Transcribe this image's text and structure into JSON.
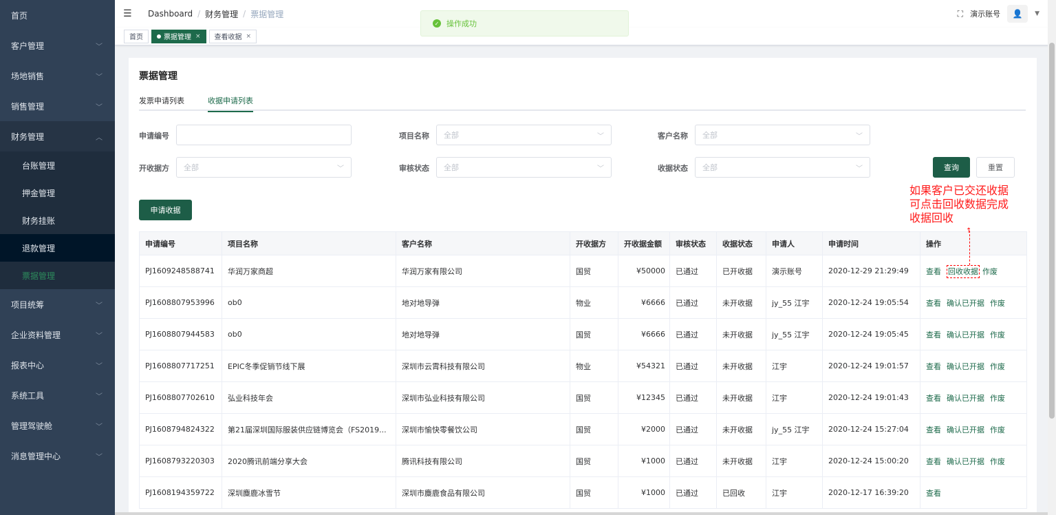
{
  "sidebar": {
    "items": [
      {
        "label": "首页",
        "has_children": false
      },
      {
        "label": "客户管理",
        "has_children": true
      },
      {
        "label": "场地销售",
        "has_children": true
      },
      {
        "label": "销售管理",
        "has_children": true
      },
      {
        "label": "财务管理",
        "has_children": true,
        "open": true
      },
      {
        "label": "项目统筹",
        "has_children": true
      },
      {
        "label": "企业资料管理",
        "has_children": true
      },
      {
        "label": "报表中心",
        "has_children": true
      },
      {
        "label": "系统工具",
        "has_children": true
      },
      {
        "label": "管理驾驶舱",
        "has_children": true
      },
      {
        "label": "消息管理中心",
        "has_children": true
      }
    ],
    "finance_sub": [
      "台账管理",
      "押金管理",
      "财务挂账",
      "退款管理",
      "票据管理"
    ]
  },
  "header": {
    "breadcrumb": [
      "Dashboard",
      "财务管理",
      "票据管理"
    ],
    "account": "演示账号"
  },
  "tags": [
    {
      "label": "首页",
      "active": false,
      "closable": false
    },
    {
      "label": "票据管理",
      "active": true,
      "closable": true
    },
    {
      "label": "查看收据",
      "active": false,
      "closable": true
    }
  ],
  "toast": {
    "message": "操作成功"
  },
  "page": {
    "title": "票据管理",
    "tabs": [
      "发票申请列表",
      "收据申请列表"
    ]
  },
  "filters": {
    "apply_no_label": "申请编号",
    "project_label": "项目名称",
    "project_placeholder": "全部",
    "customer_label": "客户名称",
    "customer_placeholder": "全部",
    "issuer_label": "开收据方",
    "issuer_placeholder": "全部",
    "audit_label": "审核状态",
    "audit_placeholder": "全部",
    "receipt_status_label": "收据状态",
    "receipt_status_placeholder": "全部",
    "query_button": "查询",
    "reset_button": "重置"
  },
  "apply_button": "申请收据",
  "annotation": {
    "lines": [
      "如果客户已交还收据",
      "可点击回收数据完成",
      "收据回收"
    ]
  },
  "table": {
    "columns": [
      "申请编号",
      "项目名称",
      "客户名称",
      "开收据方",
      "开收据金额",
      "审核状态",
      "收据状态",
      "申请人",
      "申请时间",
      "操作"
    ],
    "rows": [
      {
        "no": "PJ1609248588741",
        "project": "华润万家商超",
        "customer": "华润万家有限公司",
        "issuer": "国贸",
        "amount": "¥50000",
        "audit": "已通过",
        "status": "已开收据",
        "applicant": "演示账号",
        "time": "2020-12-29 21:29:49",
        "ops": [
          "查看",
          "回收收据",
          "作废"
        ]
      },
      {
        "no": "PJ1608807953996",
        "project": "ob0",
        "customer": "地对地导弹",
        "issuer": "物业",
        "amount": "¥6666",
        "audit": "已通过",
        "status": "未开收据",
        "applicant": "jy_55 江宇",
        "time": "2020-12-24 19:05:54",
        "ops": [
          "查看",
          "确认已开据",
          "作废"
        ]
      },
      {
        "no": "PJ1608807944583",
        "project": "ob0",
        "customer": "地对地导弹",
        "issuer": "国贸",
        "amount": "¥6666",
        "audit": "已通过",
        "status": "未开收据",
        "applicant": "jy_55 江宇",
        "time": "2020-12-24 19:05:45",
        "ops": [
          "查看",
          "确认已开据",
          "作废"
        ]
      },
      {
        "no": "PJ1608807717251",
        "project": "EPIC冬季促销节线下展",
        "customer": "深圳市云霄科技有限公司",
        "issuer": "物业",
        "amount": "¥54321",
        "audit": "已通过",
        "status": "未开收据",
        "applicant": "江宇",
        "time": "2020-12-24 19:01:57",
        "ops": [
          "查看",
          "确认已开据",
          "作废"
        ]
      },
      {
        "no": "PJ1608807702610",
        "project": "弘业科技年会",
        "customer": "深圳市弘业科技有限公司",
        "issuer": "国贸",
        "amount": "¥12345",
        "audit": "已通过",
        "status": "未开收据",
        "applicant": "江宇",
        "time": "2020-12-24 19:01:43",
        "ops": [
          "查看",
          "确认已开据",
          "作废"
        ]
      },
      {
        "no": "PJ1608794824322",
        "project": "第21届深圳国际服装供应链博览会（FS2019...",
        "customer": "深圳市愉快零餐饮公司",
        "issuer": "国贸",
        "amount": "¥2000",
        "audit": "已通过",
        "status": "未开收据",
        "applicant": "jy_55 江宇",
        "time": "2020-12-24 15:27:04",
        "ops": [
          "查看",
          "确认已开据",
          "作废"
        ]
      },
      {
        "no": "PJ1608793220303",
        "project": "2020腾讯前端分享大会",
        "customer": "腾讯科技有限公司",
        "issuer": "国贸",
        "amount": "¥1000",
        "audit": "已通过",
        "status": "未开收据",
        "applicant": "江宇",
        "time": "2020-12-24 15:00:20",
        "ops": [
          "查看",
          "确认已开据",
          "作废"
        ]
      },
      {
        "no": "PJ1608194359722",
        "project": "深圳麋鹿冰雪节",
        "customer": "深圳市麋鹿食品有限公司",
        "issuer": "国贸",
        "amount": "¥1000",
        "audit": "已通过",
        "status": "已回收",
        "applicant": "江宇",
        "time": "2020-12-17 16:39:20",
        "ops": [
          "查看"
        ]
      }
    ]
  },
  "colors": {
    "primary": "#1d5d47",
    "sidebar_bg": "#304156",
    "annotation": "#ff1a1a",
    "success": "#67c23a"
  }
}
